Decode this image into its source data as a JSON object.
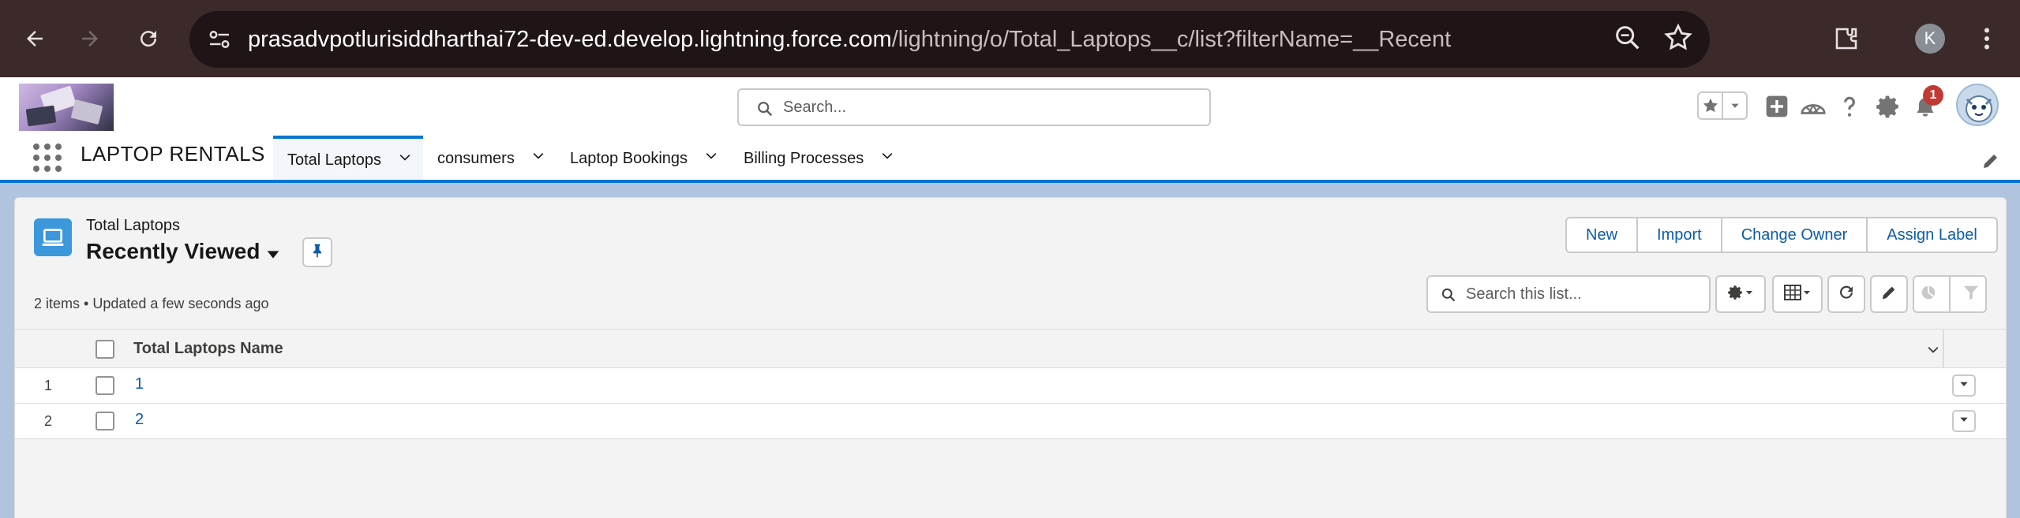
{
  "browser": {
    "url_host": "prasadvpotlurisiddharthai72-dev-ed.develop.lightning.force.com",
    "url_path": "/lightning/o/Total_Laptops__c/list?filterName=__Recent",
    "profile_initial": "K"
  },
  "header": {
    "search_placeholder": "Search...",
    "notification_count": "1"
  },
  "nav": {
    "app_name": "LAPTOP RENTALS",
    "tabs": [
      {
        "label": "Total Laptops"
      },
      {
        "label": "consumers"
      },
      {
        "label": "Laptop Bookings"
      },
      {
        "label": "Billing Processes"
      }
    ]
  },
  "list": {
    "object_label": "Total Laptops",
    "view_name": "Recently Viewed",
    "meta": "2 items • Updated a few seconds ago",
    "buttons": {
      "new": "New",
      "import": "Import",
      "change_owner": "Change Owner",
      "assign_label": "Assign Label"
    },
    "search_placeholder": "Search this list...",
    "column_header": "Total Laptops Name",
    "rows": [
      {
        "num": "1",
        "name": "1"
      },
      {
        "num": "2",
        "name": "2"
      }
    ]
  },
  "colors": {
    "brand_blue": "#0176d3",
    "link_blue": "#0b5cab",
    "chrome_bg": "#3c2a2a",
    "object_icon": "#3c97dd",
    "badge_red": "#c23934"
  }
}
